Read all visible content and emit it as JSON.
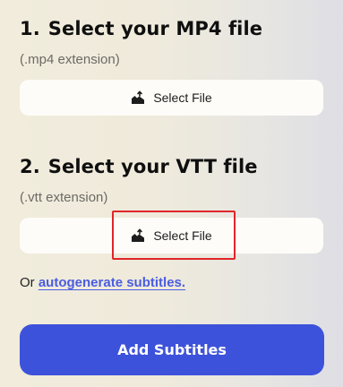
{
  "mp4_section": {
    "number": "1.",
    "title": "Select your MP4 file",
    "hint": "(.mp4 extension)",
    "button_label": "Select File",
    "button_icon": "upload-icon"
  },
  "vtt_section": {
    "number": "2.",
    "title": "Select your VTT file",
    "hint": "(.vtt extension)",
    "button_label": "Select File",
    "button_icon": "upload-icon"
  },
  "autogenerate": {
    "prefix": "Or",
    "link_text": "autogenerate subtitles."
  },
  "submit": {
    "label": "Add Subtitles"
  },
  "colors": {
    "accent": "#3d52da",
    "link": "#4a5de0",
    "highlight": "#e0262a",
    "button_bg": "#fdfcf8"
  }
}
